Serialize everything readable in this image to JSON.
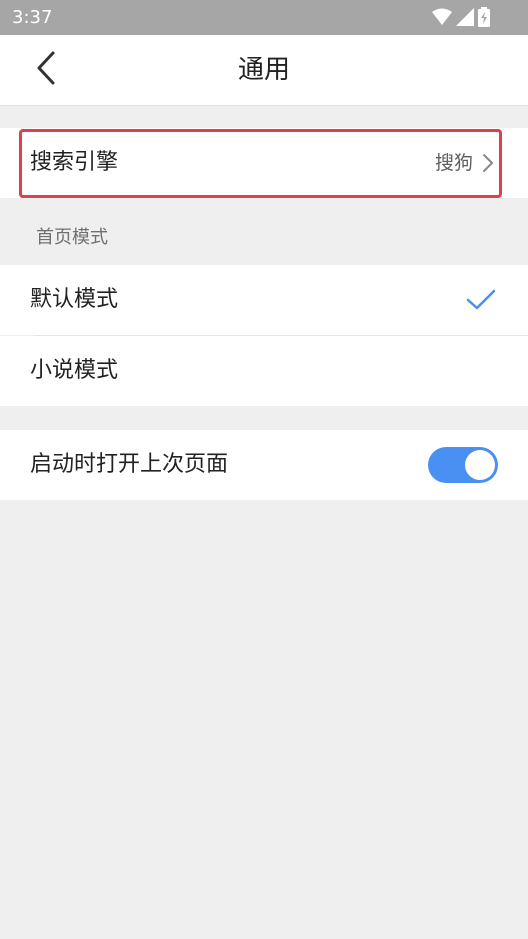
{
  "status_bar": {
    "time": "3:37",
    "icons": [
      "wifi-icon",
      "signal-icon",
      "battery-charging-icon"
    ]
  },
  "header": {
    "title": "通用",
    "back_icon": "chevron-left-icon"
  },
  "search_engine": {
    "label": "搜索引擎",
    "value": "搜狗",
    "chevron_icon": "chevron-right-icon",
    "highlighted": true
  },
  "home_mode": {
    "section_title": "首页模式",
    "options": [
      {
        "label": "默认模式",
        "selected": true
      },
      {
        "label": "小说模式",
        "selected": false
      }
    ],
    "check_icon": "checkmark-icon"
  },
  "startup": {
    "label": "启动时打开上次页面",
    "enabled": true
  },
  "colors": {
    "accent": "#4a8ff2",
    "highlight_border": "#d9434b",
    "status_bar": "#a6a6a6",
    "background": "#efefef"
  }
}
